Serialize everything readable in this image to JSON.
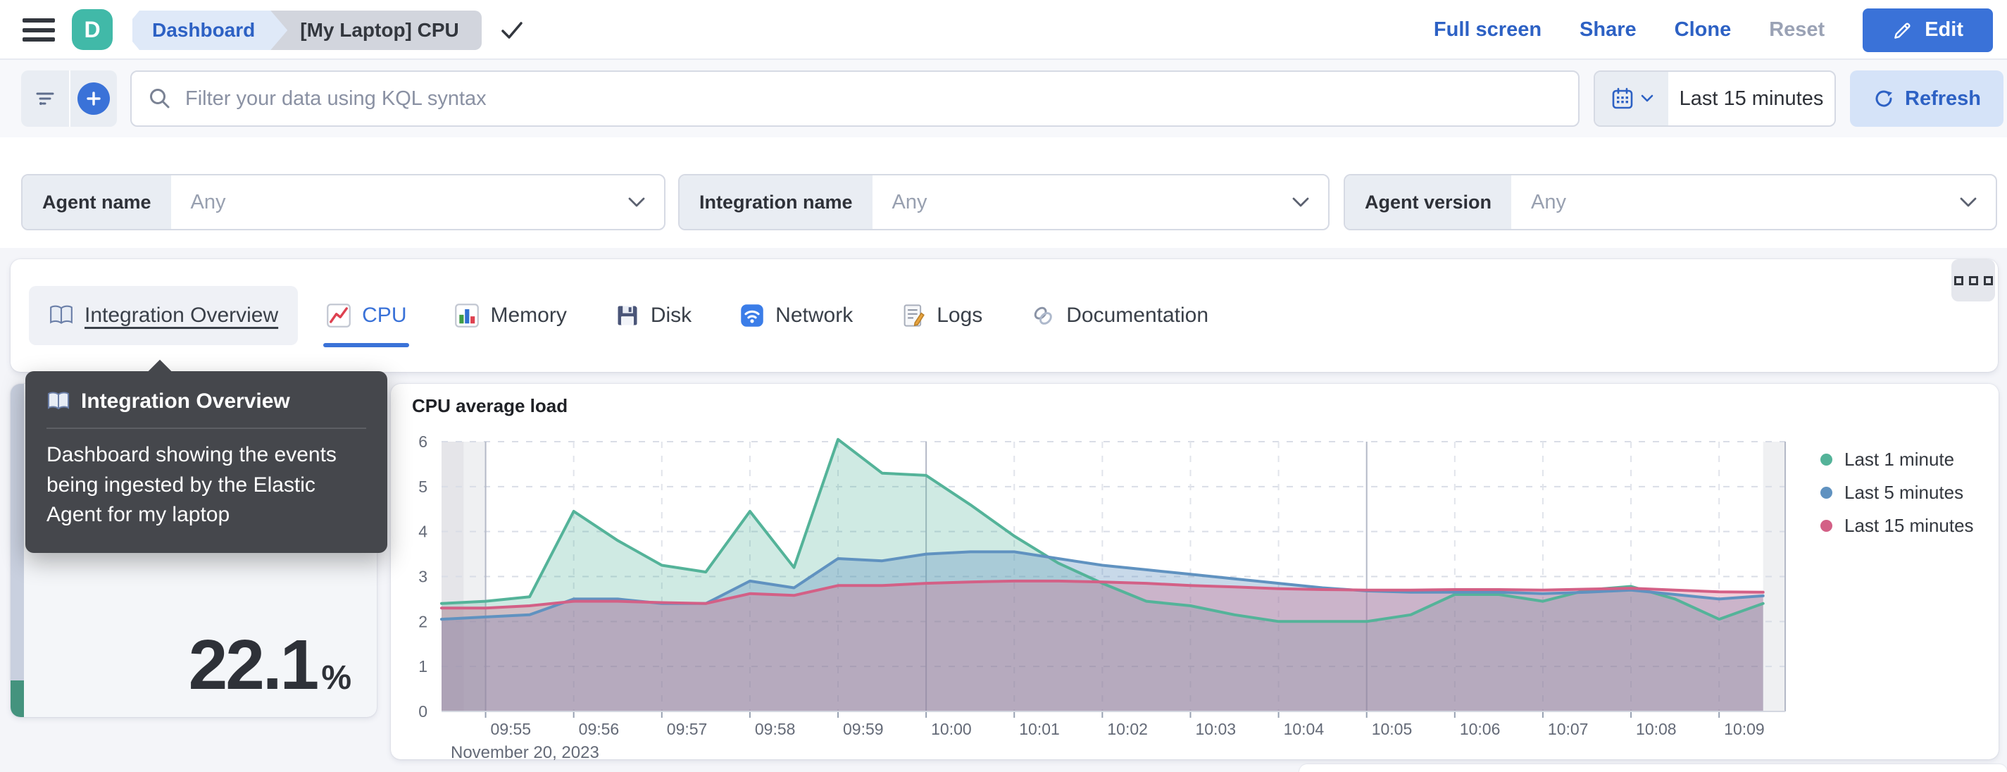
{
  "topnav": {
    "space_initial": "D",
    "breadcrumbs": [
      "Dashboard",
      "[My Laptop] CPU"
    ],
    "actions": [
      "Full screen",
      "Share",
      "Clone",
      "Reset"
    ],
    "edit_label": "Edit"
  },
  "querybar": {
    "placeholder": "Filter your data using KQL syntax",
    "time_range": "Last 15 minutes",
    "refresh_label": "Refresh"
  },
  "filters": [
    {
      "label": "Agent name",
      "value": "Any"
    },
    {
      "label": "Integration name",
      "value": "Any"
    },
    {
      "label": "Agent version",
      "value": "Any"
    }
  ],
  "tabs": [
    {
      "label": "Integration Overview",
      "icon": "book-icon",
      "state": "hovered"
    },
    {
      "label": "CPU",
      "icon": "chart-increasing-icon",
      "state": "selected"
    },
    {
      "label": "Memory",
      "icon": "bar-chart-icon",
      "state": ""
    },
    {
      "label": "Disk",
      "icon": "floppy-disk-icon",
      "state": ""
    },
    {
      "label": "Network",
      "icon": "wifi-icon",
      "state": ""
    },
    {
      "label": "Logs",
      "icon": "memo-icon",
      "state": ""
    },
    {
      "label": "Documentation",
      "icon": "link-icon",
      "state": ""
    }
  ],
  "tooltip": {
    "title": "Integration Overview",
    "body": "Dashboard showing the events being ingested by the Elastic Agent for my laptop"
  },
  "metric": {
    "value": "22.1",
    "unit": "%",
    "bar_fill_percent": 11
  },
  "chart_data": {
    "type": "area",
    "title": "CPU average load",
    "date_label": "November 20, 2023",
    "ylim": [
      0,
      6
    ],
    "y_ticks": [
      0,
      1,
      2,
      3,
      4,
      5,
      6
    ],
    "grid": true,
    "legend_position": "right",
    "time_domain": [
      "09:54:30",
      "10:09:45"
    ],
    "points_start": "09:54:30",
    "points_step_seconds": 30,
    "partial_buckets": {
      "left_until": "09:55:00",
      "right_from": "10:09:30"
    },
    "x_ticks": [
      {
        "time": "09:55:00",
        "label": "09:55",
        "major": true
      },
      {
        "time": "09:56:00",
        "label": "09:56",
        "major": false
      },
      {
        "time": "09:57:00",
        "label": "09:57",
        "major": false
      },
      {
        "time": "09:58:00",
        "label": "09:58",
        "major": false
      },
      {
        "time": "09:59:00",
        "label": "09:59",
        "major": false
      },
      {
        "time": "10:00:00",
        "label": "10:00",
        "major": true
      },
      {
        "time": "10:01:00",
        "label": "10:01",
        "major": false
      },
      {
        "time": "10:02:00",
        "label": "10:02",
        "major": false
      },
      {
        "time": "10:03:00",
        "label": "10:03",
        "major": false
      },
      {
        "time": "10:04:00",
        "label": "10:04",
        "major": false
      },
      {
        "time": "10:05:00",
        "label": "10:05",
        "major": true
      },
      {
        "time": "10:06:00",
        "label": "10:06",
        "major": false
      },
      {
        "time": "10:07:00",
        "label": "10:07",
        "major": false
      },
      {
        "time": "10:08:00",
        "label": "10:08",
        "major": false
      },
      {
        "time": "10:09:00",
        "label": "10:09",
        "major": false
      }
    ],
    "series": [
      {
        "name": "Last 1 minute",
        "color": "#54B399",
        "values": [
          2.4,
          2.45,
          2.55,
          4.45,
          3.8,
          3.25,
          3.1,
          4.45,
          3.2,
          6.05,
          5.3,
          5.25,
          4.6,
          3.9,
          3.3,
          2.85,
          2.45,
          2.35,
          2.15,
          2.0,
          2.0,
          2.0,
          2.15,
          2.6,
          2.6,
          2.45,
          2.7,
          2.78,
          2.5,
          2.05,
          2.4
        ]
      },
      {
        "name": "Last 5 minutes",
        "color": "#6092C0",
        "values": [
          2.05,
          2.1,
          2.15,
          2.5,
          2.5,
          2.4,
          2.4,
          2.9,
          2.75,
          3.4,
          3.35,
          3.5,
          3.55,
          3.55,
          3.4,
          3.25,
          3.15,
          3.05,
          2.95,
          2.85,
          2.75,
          2.68,
          2.65,
          2.65,
          2.65,
          2.62,
          2.65,
          2.7,
          2.6,
          2.5,
          2.57
        ]
      },
      {
        "name": "Last 15 minutes",
        "color": "#D36086",
        "values": [
          2.3,
          2.3,
          2.35,
          2.45,
          2.45,
          2.42,
          2.4,
          2.62,
          2.58,
          2.8,
          2.8,
          2.85,
          2.88,
          2.9,
          2.9,
          2.88,
          2.85,
          2.8,
          2.77,
          2.73,
          2.71,
          2.7,
          2.7,
          2.71,
          2.71,
          2.7,
          2.72,
          2.74,
          2.7,
          2.66,
          2.65
        ]
      }
    ]
  }
}
